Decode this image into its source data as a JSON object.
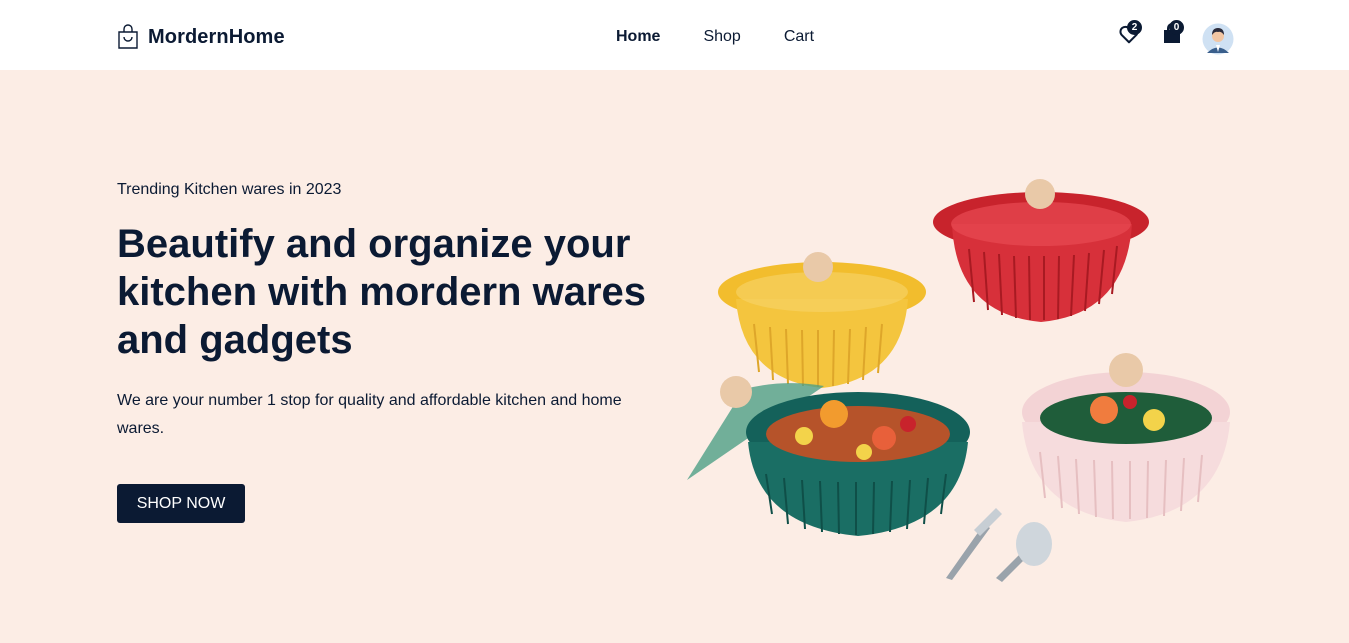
{
  "header": {
    "brand": "MordernHome",
    "brand_icon": "shopping-bag-icon",
    "nav": [
      {
        "label": "Home",
        "active": true
      },
      {
        "label": "Shop",
        "active": false
      },
      {
        "label": "Cart",
        "active": false
      }
    ],
    "wishlist_count": "2",
    "cart_count": "0",
    "icons": [
      "heart-icon",
      "shopping-bag-icon",
      "user-avatar"
    ]
  },
  "hero": {
    "eyebrow": "Trending Kitchen wares in 2023",
    "headline": "Beautify and organize your kitchen with mordern wares and gadgets",
    "description": "We are your number 1 stop for quality and affordable kitchen and home wares.",
    "cta_label": "SHOP NOW",
    "image": "ceramic-cookware-pots-illustration"
  },
  "colors": {
    "primary": "#0b1a33",
    "hero_background": "#fcede5",
    "header_background": "#ffffff"
  }
}
